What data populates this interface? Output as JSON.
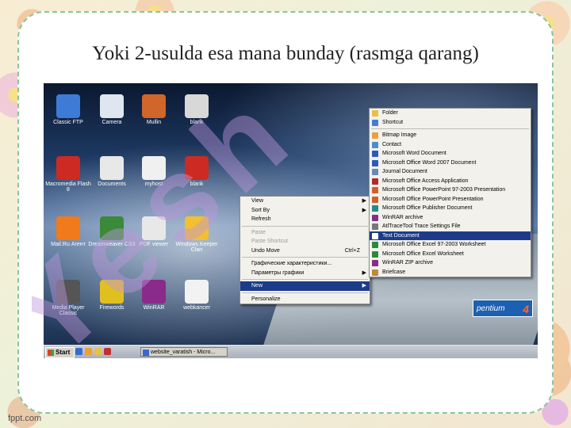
{
  "slide": {
    "title": "Yoki 2-usulda esa mana bunday (rasmga qarang)",
    "footer_logo": "fppt.com",
    "watermark_text": "Yesh"
  },
  "desktop": {
    "icons": [
      {
        "label": "Classic FTP",
        "color": "#3d7bd6",
        "icon": "ftp-icon"
      },
      {
        "label": "Camera",
        "color": "#dfe6f0",
        "icon": "camera-icon"
      },
      {
        "label": "Mullin",
        "color": "#d0662a",
        "icon": "app-icon"
      },
      {
        "label": "blank",
        "color": "#d8d8d8",
        "icon": "blank-file-icon"
      },
      {
        "label": "Macromedia Flash 8",
        "color": "#cc2a22",
        "icon": "flash-icon"
      },
      {
        "label": "Documents",
        "color": "#e8e8e8",
        "icon": "documents-icon"
      },
      {
        "label": "myhost",
        "color": "#f0f0f0",
        "icon": "word-doc-icon"
      },
      {
        "label": "blank",
        "color": "#cc2a22",
        "icon": "flash-file-icon"
      },
      {
        "label": "Mail.Ru Агент",
        "color": "#f07a1c",
        "icon": "mail-agent-icon"
      },
      {
        "label": "Dreamweaver CS3",
        "color": "#3a8a3a",
        "icon": "dreamweaver-icon"
      },
      {
        "label": "PDF viewer",
        "color": "#e8e8e8",
        "icon": "pdf-viewer-icon"
      },
      {
        "label": "Windows Keeper Clan",
        "color": "#f2c030",
        "icon": "keeper-icon"
      },
      {
        "label": "Media Player Classic",
        "color": "#555",
        "icon": "media-player-icon"
      },
      {
        "label": "Firewords",
        "color": "#e0c020",
        "icon": "fireworks-icon"
      },
      {
        "label": "WinRAR",
        "color": "#8a2a8a",
        "icon": "winrar-icon"
      },
      {
        "label": "webkancer",
        "color": "#f2f2f2",
        "icon": "blank-file-icon"
      }
    ]
  },
  "context_menu": {
    "items": [
      {
        "label": "View",
        "arrow": "▶",
        "state": "normal"
      },
      {
        "label": "Sort By",
        "arrow": "▶",
        "state": "normal"
      },
      {
        "label": "Refresh",
        "arrow": "",
        "state": "normal"
      },
      {
        "sep": true
      },
      {
        "label": "Paste",
        "arrow": "",
        "state": "disabled"
      },
      {
        "label": "Paste Shortcut",
        "arrow": "",
        "state": "disabled"
      },
      {
        "label": "Undo Move",
        "shortcut": "Ctrl+Z",
        "arrow": "",
        "state": "normal"
      },
      {
        "sep": true
      },
      {
        "label": "Графические характеристики...",
        "arrow": "",
        "state": "normal"
      },
      {
        "label": "Параметры графики",
        "arrow": "▶",
        "state": "normal"
      },
      {
        "sep": true
      },
      {
        "label": "New",
        "arrow": "▶",
        "state": "highlighted"
      },
      {
        "sep": true
      },
      {
        "label": "Personalize",
        "arrow": "",
        "state": "normal"
      }
    ]
  },
  "new_submenu": {
    "items": [
      {
        "label": "Folder",
        "color": "#e8c04a"
      },
      {
        "label": "Shortcut",
        "color": "#4a7ad8"
      },
      {
        "sep": true
      },
      {
        "label": "Bitmap Image",
        "color": "#e8a040"
      },
      {
        "label": "Contact",
        "color": "#4a90c8"
      },
      {
        "label": "Microsoft Word Document",
        "color": "#2b5bb8"
      },
      {
        "label": "Microsoft Office Word 2007 Document",
        "color": "#2b5bb8"
      },
      {
        "label": "Journal Document",
        "color": "#6a8ab0"
      },
      {
        "label": "Microsoft Office Access Application",
        "color": "#b02a2a"
      },
      {
        "label": "Microsoft Office PowerPoint 97-2003 Presentation",
        "color": "#d0602a"
      },
      {
        "label": "Microsoft Office PowerPoint Presentation",
        "color": "#d0602a"
      },
      {
        "label": "Microsoft Office Publisher Document",
        "color": "#2a8a8a"
      },
      {
        "label": "WinRAR archive",
        "color": "#8a2a8a"
      },
      {
        "label": "AtlTraceTool Trace Settings File",
        "color": "#777"
      },
      {
        "label": "Text Document",
        "color": "#ffffff",
        "highlighted": true
      },
      {
        "label": "Microsoft Office Excel 97-2003 Worksheet",
        "color": "#2a8a3a"
      },
      {
        "label": "Microsoft Office Excel Worksheet",
        "color": "#2a8a3a"
      },
      {
        "label": "WinRAR ZIP archive",
        "color": "#8a2a8a"
      },
      {
        "label": "Briefcase",
        "color": "#c08a3a"
      }
    ]
  },
  "taskbar": {
    "start_label": "Start",
    "task_label": "website_varatish - Micro..."
  },
  "badge": {
    "brand": "pentium",
    "number": "4"
  }
}
